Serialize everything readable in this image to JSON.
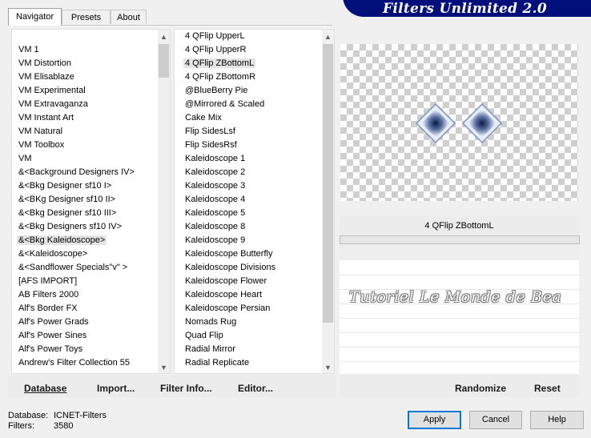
{
  "header": {
    "title": "Filters Unlimited 2.0"
  },
  "tabs": [
    {
      "label": "Navigator",
      "active": true
    },
    {
      "label": "Presets",
      "active": false
    },
    {
      "label": "About",
      "active": false
    }
  ],
  "categories": {
    "items": [
      "VM 1",
      "VM Distortion",
      "VM Elisablaze",
      "VM Experimental",
      "VM Extravaganza",
      "VM Instant Art",
      "VM Natural",
      "VM Toolbox",
      "VM",
      "&<Background Designers IV>",
      "&<Bkg Designer sf10 I>",
      "&<BKg Designer sf10 II>",
      "&<Bkg Designer sf10 III>",
      "&<Bkg Designers sf10 IV>",
      "&<Bkg Kaleidoscope>",
      "&<Kaleidoscope>",
      "&<Sandflower Specials\"v\" >",
      "[AFS IMPORT]",
      "AB Filters 2000",
      "Alf's Border FX",
      "Alf's Power Grads",
      "Alf's Power Sines",
      "Alf's Power Toys",
      "Andrew's Filter Collection 55"
    ],
    "selected_index": 14
  },
  "filters": {
    "items": [
      "4 QFlip UpperL",
      "4 QFlip UpperR",
      "4 QFlip ZBottomL",
      "4 QFlip ZBottomR",
      "@BlueBerry Pie",
      "@Mirrored & Scaled",
      "Cake Mix",
      "Flip SidesLsf",
      "Flip SidesRsf",
      "Kaleidoscope 1",
      "Kaleidoscope 2",
      "Kaleidoscope 3",
      "Kaleidoscope 4",
      "Kaleidoscope 5",
      "Kaleidoscope 8",
      "Kaleidoscope 9",
      "Kaleidoscope Butterfly",
      "Kaleidoscope Divisions",
      "Kaleidoscope Flower",
      "Kaleidoscope Heart",
      "Kaleidoscope Persian",
      "Nomads Rug",
      "Quad Flip",
      "Radial Mirror",
      "Radial Replicate"
    ],
    "selected_index": 2
  },
  "preview": {
    "filter_name": "4 QFlip ZBottomL",
    "watermark": "Tutoriel Le Monde de Bea"
  },
  "left_buttons": {
    "database": "Database",
    "import": "Import...",
    "filter_info": "Filter Info...",
    "editor": "Editor..."
  },
  "right_buttons": {
    "randomize": "Randomize",
    "reset": "Reset"
  },
  "status": {
    "database_label": "Database:",
    "database_value": "ICNET-Filters",
    "filters_label": "Filters:",
    "filters_value": "3580"
  },
  "dialog_buttons": {
    "apply": "Apply",
    "cancel": "Cancel",
    "help": "Help"
  },
  "colors": {
    "banner": "#000f7a",
    "default_button_border": "#0078d7",
    "selection": "#e4e4e4"
  }
}
